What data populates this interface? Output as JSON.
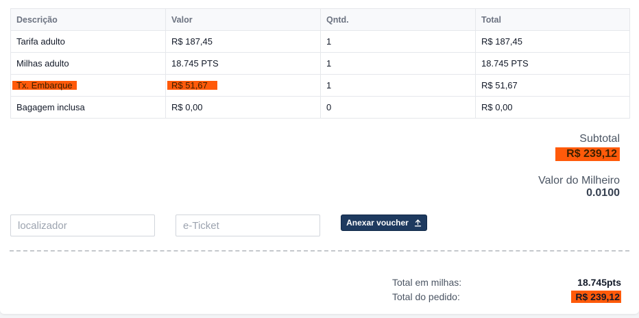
{
  "table": {
    "headers": [
      "Descrição",
      "Valor",
      "Qntd.",
      "Total"
    ],
    "rows": [
      {
        "descricao": "Tarifa adulto",
        "valor": "R$ 187,45",
        "qntd": "1",
        "total": "R$ 187,45"
      },
      {
        "descricao": "Milhas adulto",
        "valor": "18.745 PTS",
        "qntd": "1",
        "total": "18.745 PTS"
      },
      {
        "descricao": "Tx. Embarque",
        "valor": "R$ 51,67",
        "qntd": "1",
        "total": "R$ 51,67"
      },
      {
        "descricao": "Bagagem inclusa",
        "valor": "R$ 0,00",
        "qntd": "0",
        "total": "R$ 0,00"
      }
    ]
  },
  "summary": {
    "subtotal_label": "Subtotal",
    "subtotal_value": "R$ 239,12",
    "milheiro_label": "Valor do Milheiro",
    "milheiro_value": "0.0100"
  },
  "form": {
    "localizador_placeholder": "localizador",
    "localizador_value": "",
    "eticket_placeholder": "e-Ticket",
    "eticket_value": "",
    "voucher_button_label": "Anexar voucher",
    "voucher_icon": "upload-icon"
  },
  "totals": {
    "milhas_label": "Total em milhas:",
    "milhas_value": "18.745pts",
    "pedido_label": "Total do pedido:",
    "pedido_value": "R$ 239,12"
  },
  "colors": {
    "highlight": "#ff5a0a",
    "button_bg": "#1e3a5f"
  }
}
